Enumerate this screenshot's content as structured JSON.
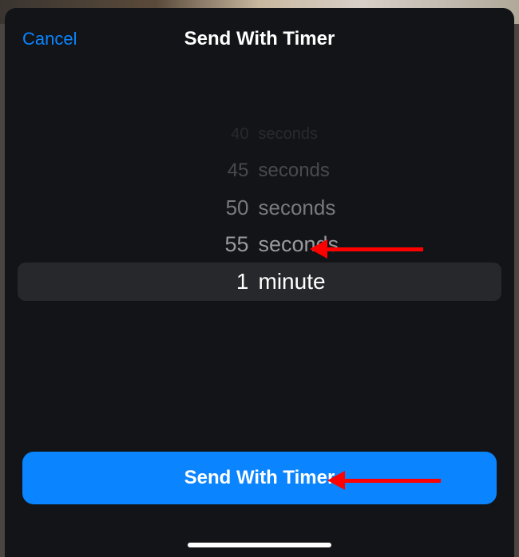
{
  "header": {
    "cancel_label": "Cancel",
    "title": "Send With Timer"
  },
  "picker": {
    "rows": [
      {
        "num": "40",
        "unit": "seconds"
      },
      {
        "num": "45",
        "unit": "seconds"
      },
      {
        "num": "50",
        "unit": "seconds"
      },
      {
        "num": "55",
        "unit": "seconds"
      },
      {
        "num": "1",
        "unit": "minute"
      }
    ],
    "selected_index": 4
  },
  "action": {
    "send_label": "Send With Timer"
  }
}
